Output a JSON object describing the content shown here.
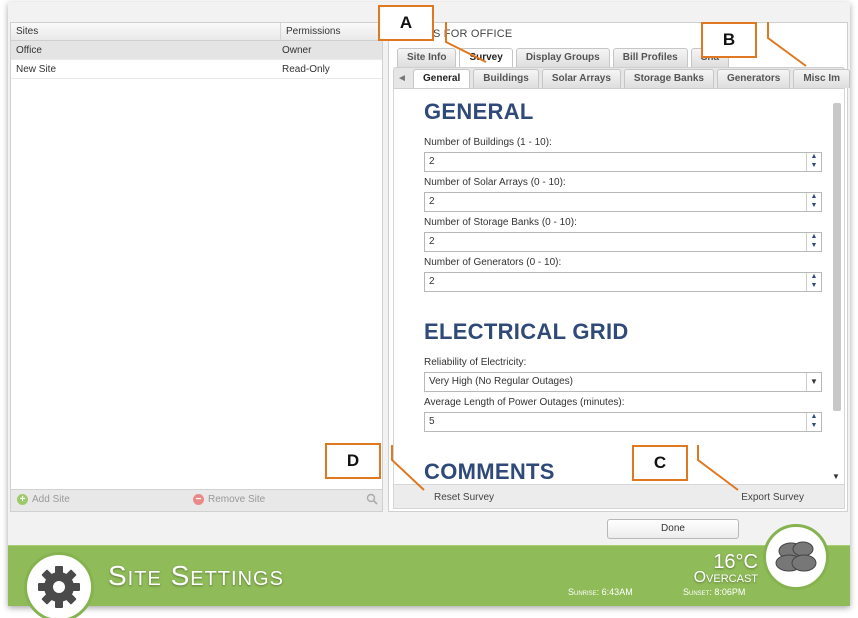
{
  "sites_panel": {
    "col_sites": "Sites",
    "col_permissions": "Permissions",
    "rows": [
      {
        "name": "Office",
        "permission": "Owner"
      },
      {
        "name": "New Site",
        "permission": "Read-Only"
      }
    ],
    "add_site_label": "Add Site",
    "remove_site_label": "Remove Site"
  },
  "settings_panel": {
    "title": "S FOR OFFICE",
    "main_tabs": [
      "Site Info",
      "Survey",
      "Display Groups",
      "Bill Profiles",
      "Sha"
    ],
    "active_main_tab": "Survey",
    "sub_tabs": [
      "General",
      "Buildings",
      "Solar Arrays",
      "Storage Banks",
      "Generators",
      "Misc Im"
    ],
    "active_sub_tab": "General",
    "general": {
      "heading": "GENERAL",
      "buildings_label": "Number of Buildings (1 - 10):",
      "buildings_value": "2",
      "solar_label": "Number of Solar Arrays (0 - 10):",
      "solar_value": "2",
      "storage_label": "Number of Storage Banks (0 - 10):",
      "storage_value": "2",
      "generators_label": "Number of Generators (0 - 10):",
      "generators_value": "2"
    },
    "grid": {
      "heading": "ELECTRICAL GRID",
      "reliability_label": "Reliability of Electricity:",
      "reliability_value": "Very High (No Regular Outages)",
      "outage_label": "Average Length of Power Outages (minutes):",
      "outage_value": "5"
    },
    "comments": {
      "heading": "COMMENTS"
    },
    "reset_label": "Reset Survey",
    "export_label": "Export Survey"
  },
  "done_label": "Done",
  "banner": {
    "title": "Site Settings",
    "temperature": "16°C",
    "condition": "Overcast",
    "sunrise": "Sunrise: 6:43AM",
    "sunset": "Sunset: 8:06PM",
    "bg_color": "#8fbb59"
  },
  "callouts": {
    "a": "A",
    "b": "B",
    "c": "C",
    "d": "D",
    "color": "#e07820"
  }
}
